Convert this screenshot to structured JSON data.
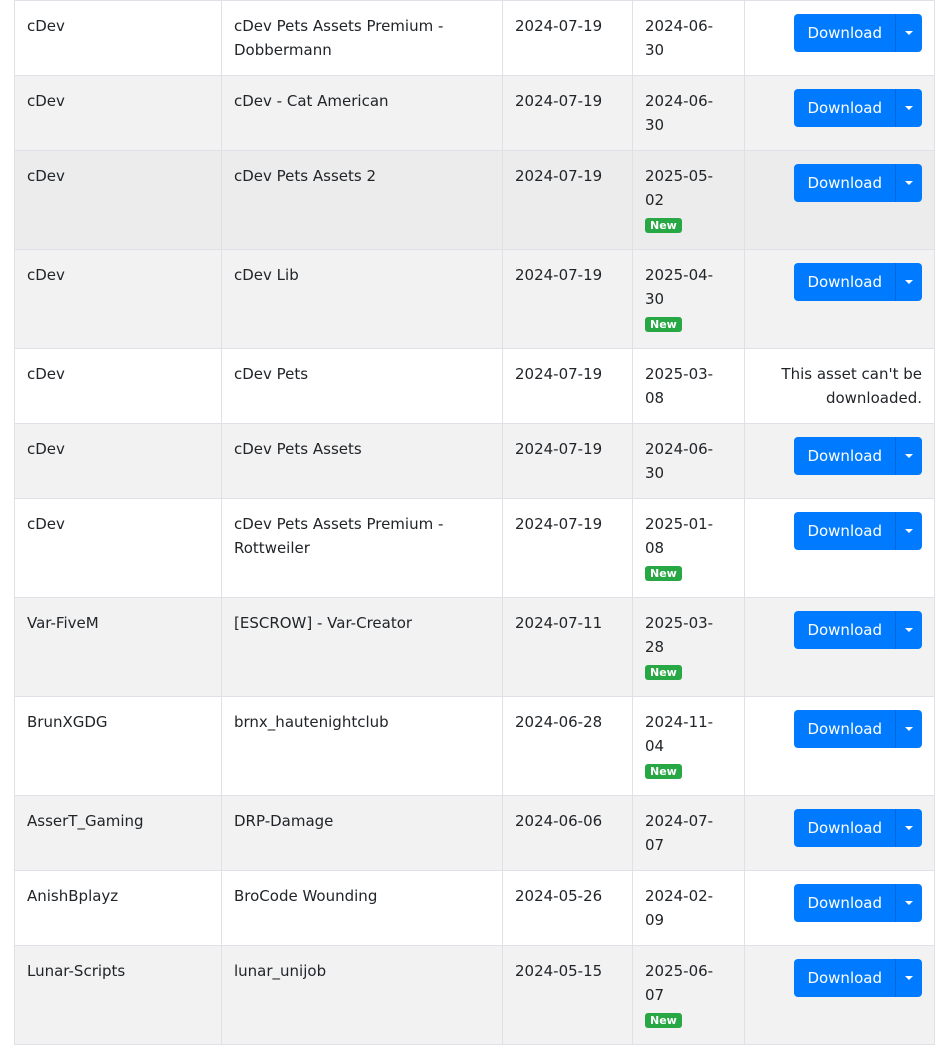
{
  "table": {
    "download_label": "Download",
    "new_badge": "New",
    "rows": [
      {
        "author": "cDev",
        "name": "cDev Pets Assets Premium - Dobbermann",
        "date1": "2024-07-19",
        "date2": "2024-06-30",
        "new": false,
        "downloadable": true
      },
      {
        "author": "cDev",
        "name": "cDev - Cat American",
        "date1": "2024-07-19",
        "date2": "2024-06-30",
        "new": false,
        "downloadable": true
      },
      {
        "author": "cDev",
        "name": "cDev Pets Assets 2",
        "date1": "2024-07-19",
        "date2": "2025-05-02",
        "new": true,
        "downloadable": true
      },
      {
        "author": "cDev",
        "name": "cDev Lib",
        "date1": "2024-07-19",
        "date2": "2025-04-30",
        "new": true,
        "downloadable": true
      },
      {
        "author": "cDev",
        "name": "cDev Pets",
        "date1": "2024-07-19",
        "date2": "2025-03-08",
        "new": false,
        "downloadable": false,
        "message": "This asset can't be downloaded."
      },
      {
        "author": "cDev",
        "name": "cDev Pets Assets",
        "date1": "2024-07-19",
        "date2": "2024-06-30",
        "new": false,
        "downloadable": true
      },
      {
        "author": "cDev",
        "name": "cDev Pets Assets Premium - Rottweiler",
        "date1": "2024-07-19",
        "date2": "2025-01-08",
        "new": true,
        "downloadable": true
      },
      {
        "author": "Var-FiveM",
        "name": "[ESCROW] - Var-Creator",
        "date1": "2024-07-11",
        "date2": "2025-03-28",
        "new": true,
        "downloadable": true
      },
      {
        "author": "BrunXGDG",
        "name": "brnx_hautenightclub",
        "date1": "2024-06-28",
        "date2": "2024-11-04",
        "new": true,
        "downloadable": true
      },
      {
        "author": "AsserT_Gaming",
        "name": "DRP-Damage",
        "date1": "2024-06-06",
        "date2": "2024-07-07",
        "new": false,
        "downloadable": true
      },
      {
        "author": "AnishBplayz",
        "name": "BroCode Wounding",
        "date1": "2024-05-26",
        "date2": "2024-02-09",
        "new": false,
        "downloadable": true
      },
      {
        "author": "Lunar-Scripts",
        "name": "lunar_unijob",
        "date1": "2024-05-15",
        "date2": "2025-06-07",
        "new": true,
        "downloadable": true
      }
    ]
  },
  "colors": {
    "primary": "#007bff",
    "success": "#28a745",
    "stripe": "#f2f2f2",
    "border": "#dee2e6"
  }
}
